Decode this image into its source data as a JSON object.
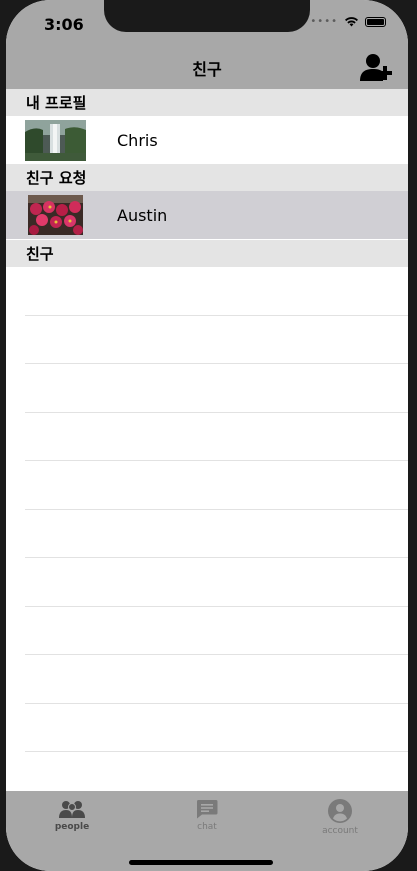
{
  "status_bar": {
    "time": "3:06"
  },
  "nav": {
    "title": "친구",
    "add_icon": "add-friend-icon"
  },
  "sections": {
    "profile": "내 프로필",
    "requests": "친구 요청",
    "friends": "친구"
  },
  "profile_row": {
    "name": "Chris",
    "thumb": "waterfall-photo"
  },
  "request_row": {
    "name": "Austin",
    "thumb": "flower-photo"
  },
  "tabs": [
    {
      "label": "people",
      "icon": "people-icon"
    },
    {
      "label": "chat",
      "icon": "chat-icon"
    },
    {
      "label": "account",
      "icon": "account-icon"
    }
  ],
  "colors": {
    "bar": "#a8a8a8",
    "section": "#e4e4e4",
    "selected_row": "#d0cfd4",
    "active_tab": "#4a4a4a",
    "inactive_tab": "#7a7a7a"
  }
}
